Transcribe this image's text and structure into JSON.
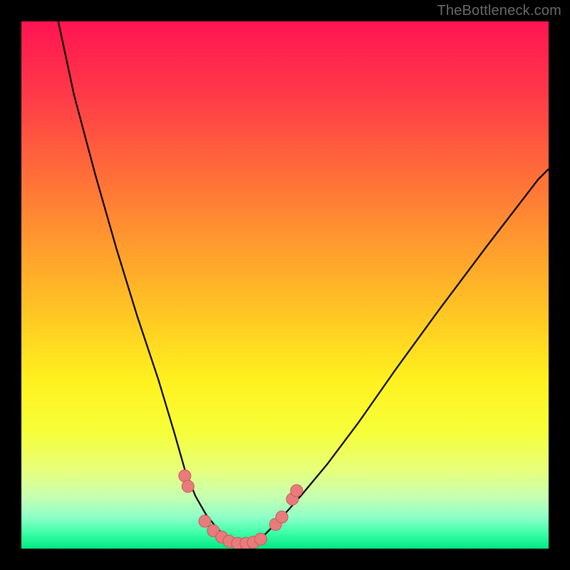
{
  "watermark": {
    "text": "TheBottleneck.com"
  },
  "colors": {
    "black": "#000000",
    "curve": "#000000",
    "marker_fill": "#e87b7b",
    "marker_stroke": "#c85a5a",
    "gradient_stops": [
      {
        "offset": "0%",
        "color": "#ff1452"
      },
      {
        "offset": "14%",
        "color": "#ff3a48"
      },
      {
        "offset": "28%",
        "color": "#ff6a3a"
      },
      {
        "offset": "42%",
        "color": "#ff9a2e"
      },
      {
        "offset": "56%",
        "color": "#ffc823"
      },
      {
        "offset": "68%",
        "color": "#fff11f"
      },
      {
        "offset": "78%",
        "color": "#f6ff3a"
      },
      {
        "offset": "85%",
        "color": "#e8ff7a"
      },
      {
        "offset": "90%",
        "color": "#c8ffb0"
      },
      {
        "offset": "94%",
        "color": "#8effc8"
      },
      {
        "offset": "97%",
        "color": "#3effa8"
      },
      {
        "offset": "100%",
        "color": "#00e884"
      }
    ]
  },
  "chart_data": {
    "type": "line",
    "title": "",
    "xlabel": "",
    "ylabel": "",
    "xlim": [
      0,
      100
    ],
    "ylim": [
      0,
      100
    ],
    "series": [
      {
        "name": "left-curve",
        "x": [
          7,
          10,
          14,
          18,
          22,
          26,
          29,
          31,
          33,
          35,
          37,
          39,
          40.5
        ],
        "y": [
          100,
          86,
          71,
          57,
          44,
          32,
          22,
          15,
          10,
          6.5,
          4,
          2,
          1
        ]
      },
      {
        "name": "right-curve",
        "x": [
          44,
          46,
          49,
          53,
          58,
          64,
          71,
          79,
          88,
          98,
          100
        ],
        "y": [
          1,
          2.5,
          5.5,
          10,
          16,
          24,
          34,
          45,
          57,
          70,
          72
        ]
      }
    ],
    "valley_markers": {
      "comment": "salmon dots near the valley floor",
      "points": [
        {
          "x": 31.0,
          "y": 13.8
        },
        {
          "x": 31.6,
          "y": 11.8
        },
        {
          "x": 34.8,
          "y": 5.2
        },
        {
          "x": 36.4,
          "y": 3.4
        },
        {
          "x": 38.0,
          "y": 2.2
        },
        {
          "x": 39.4,
          "y": 1.4
        },
        {
          "x": 41.0,
          "y": 1.0
        },
        {
          "x": 42.6,
          "y": 1.0
        },
        {
          "x": 44.0,
          "y": 1.2
        },
        {
          "x": 45.4,
          "y": 1.8
        },
        {
          "x": 48.2,
          "y": 4.6
        },
        {
          "x": 49.4,
          "y": 6.0
        },
        {
          "x": 51.4,
          "y": 9.4
        },
        {
          "x": 52.2,
          "y": 11.0
        }
      ]
    }
  }
}
